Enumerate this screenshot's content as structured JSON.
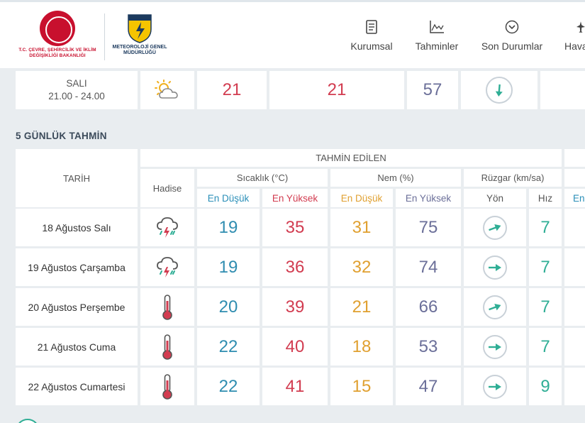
{
  "header": {
    "ministry_logo_text": "T.C. ÇEVRE, ŞEHİRCİLİK VE İKLİM DEĞİŞİKLİĞİ BAKANLIĞI",
    "mgm_logo_text": "METEOROLOJİ GENEL MÜDÜRLÜĞÜ",
    "mgm_badge_text": "METEOROLOJİ",
    "nav": [
      {
        "label": "Kurumsal",
        "icon": "document-icon"
      },
      {
        "label": "Tahminler",
        "icon": "chart-icon"
      },
      {
        "label": "Son Durumlar",
        "icon": "chevron-circle-icon"
      },
      {
        "label": "Hava",
        "icon": "plane-icon"
      }
    ]
  },
  "hourly_last_row": {
    "day": "SALI",
    "time": "21.00 - 24.00",
    "icon": "partly-cloudy-icon",
    "temp": "21",
    "feels_like": "21",
    "humidity": "57",
    "wind_icon": "arrow-down-icon"
  },
  "forecast": {
    "title": "5 GÜNLÜK TAHMİN",
    "col_date": "TARİH",
    "group_header": "TAHMİN EDİLEN",
    "col_event": "Hadise",
    "col_temp": "Sıcaklık (°C)",
    "col_humidity": "Nem (%)",
    "col_wind": "Rüzgar (km/sa)",
    "sub_low": "En Düşük",
    "sub_high": "En Yüksek",
    "sub_dir": "Yön",
    "sub_speed": "Hız",
    "sub_clipped": "En",
    "colors": {
      "low": "#2f8db0",
      "high": "#d23c50",
      "hum_low": "#e0a030",
      "hum_high": "#6b6f99",
      "speed": "#2fae95"
    },
    "rows": [
      {
        "date": "18 Ağustos Salı",
        "icon": "thunderstorm-icon",
        "temp_low": "19",
        "temp_high": "35",
        "hum_low": "31",
        "hum_high": "75",
        "wind_icon": "arrow-northeast-icon",
        "wind_speed": "7"
      },
      {
        "date": "19 Ağustos Çarşamba",
        "icon": "thunderstorm-icon",
        "temp_low": "19",
        "temp_high": "36",
        "hum_low": "32",
        "hum_high": "74",
        "wind_icon": "arrow-east-icon",
        "wind_speed": "7"
      },
      {
        "date": "20 Ağustos Perşembe",
        "icon": "thermometer-hot-icon",
        "temp_low": "20",
        "temp_high": "39",
        "hum_low": "21",
        "hum_high": "66",
        "wind_icon": "arrow-northeast-icon",
        "wind_speed": "7"
      },
      {
        "date": "21 Ağustos Cuma",
        "icon": "thermometer-hot-icon",
        "temp_low": "22",
        "temp_high": "40",
        "hum_low": "18",
        "hum_high": "53",
        "wind_icon": "arrow-east-icon",
        "wind_speed": "7"
      },
      {
        "date": "22 Ağustos Cumartesi",
        "icon": "thermometer-hot-icon",
        "temp_low": "22",
        "temp_high": "41",
        "hum_low": "15",
        "hum_high": "47",
        "wind_icon": "arrow-east-icon",
        "wind_speed": "9"
      }
    ]
  }
}
